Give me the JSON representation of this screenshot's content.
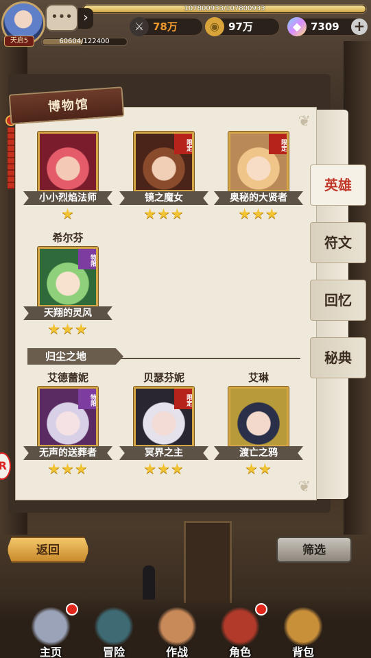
{
  "player": {
    "level_label": "天启5",
    "xp_text": "107800933/107800933",
    "xp_fraction": 1.0,
    "hp_text": "60604/122400",
    "hp_fraction": 0.495
  },
  "resources": {
    "power": {
      "icon": "crossed-swords-icon",
      "value": "78万",
      "color": "#f29a2e"
    },
    "gold": {
      "icon": "gold-coin-icon",
      "value": "97万",
      "color": "#ffffff"
    },
    "gems": {
      "icon": "gem-icon",
      "value": "7309",
      "color": "#ffffff"
    }
  },
  "museum": {
    "title": "博物馆",
    "section_title": "归尘之地",
    "heroes_top": [
      {
        "top_name": "",
        "name": "小小烈焰法师",
        "stars": "★",
        "tag": "",
        "colors": [
          "#7a1c2c",
          "#e45c6a",
          "#f4c9b6"
        ]
      },
      {
        "top_name": "",
        "name": "镜之魔女",
        "stars": "★★★",
        "tag": "限定",
        "colors": [
          "#4a2418",
          "#8a4a2c",
          "#f1cfb7"
        ]
      },
      {
        "top_name": "",
        "name": "奥秘的大贤者",
        "stars": "★★★",
        "tag": "限定",
        "colors": [
          "#b98a58",
          "#f0c58a",
          "#f7dcc6"
        ]
      },
      {
        "top_name": "希尔芬",
        "name": "天翔的灵风",
        "stars": "★★★",
        "tag": "特限",
        "colors": [
          "#2f6b3a",
          "#8fd07a",
          "#f6e2cf"
        ]
      }
    ],
    "heroes_bottom": [
      {
        "top_name": "艾德蕾妮",
        "name": "无声的送葬者",
        "stars": "★★★",
        "tag": "特限",
        "colors": [
          "#5a2a62",
          "#d7d0e6",
          "#f4e2e4"
        ]
      },
      {
        "top_name": "贝瑟芬妮",
        "name": "冥界之主",
        "stars": "★★★",
        "tag": "限定",
        "colors": [
          "#2a2630",
          "#e6e2ec",
          "#f3dbd6"
        ]
      },
      {
        "top_name": "艾琳",
        "name": "渡亡之鸦",
        "stars": "★★",
        "tag": "",
        "colors": [
          "#b79a3a",
          "#2a2f4a",
          "#f3d9cc"
        ]
      }
    ]
  },
  "tabs": [
    {
      "label": "英雄",
      "active": true
    },
    {
      "label": "符文",
      "active": false
    },
    {
      "label": "回忆",
      "active": false
    },
    {
      "label": "秘典",
      "active": false
    }
  ],
  "buttons": {
    "back": "返回",
    "filter": "筛选"
  },
  "nav": [
    {
      "label": "主页",
      "icon": "angel-statue-icon",
      "dot": true,
      "color": "#9aa3b8"
    },
    {
      "label": "冒险",
      "icon": "portal-gate-icon",
      "dot": false,
      "color": "#3e6a74"
    },
    {
      "label": "作战",
      "icon": "lion-mascot-icon",
      "dot": false,
      "color": "#c98a5a"
    },
    {
      "label": "角色",
      "icon": "character-portrait-icon",
      "dot": true,
      "color": "#b23a2a"
    },
    {
      "label": "背包",
      "icon": "backpack-icon",
      "dot": false,
      "color": "#c9903a"
    }
  ]
}
